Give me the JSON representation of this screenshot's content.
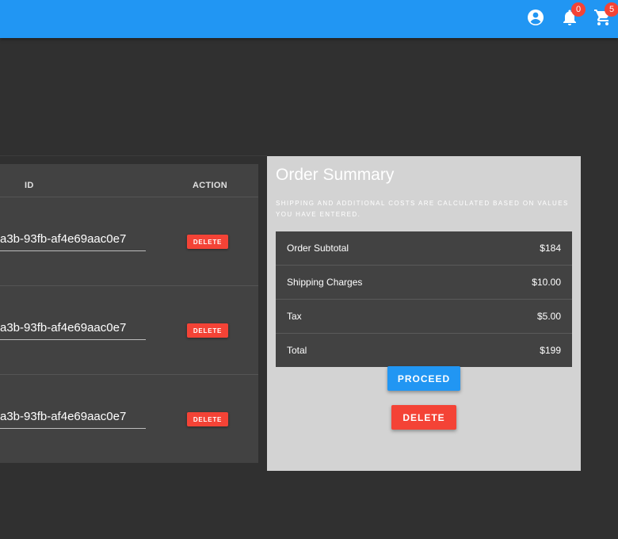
{
  "header": {
    "icons": [
      "account-circle-icon",
      "bell-icon",
      "cart-icon"
    ],
    "notification_count": "0",
    "cart_count": "5",
    "accent_color": "#2196f3"
  },
  "items_table": {
    "columns": {
      "id": "ID",
      "action": "ACTION"
    },
    "rows": [
      {
        "id": "a3b-93fb-af4e69aac0e7",
        "action": "DELETE"
      },
      {
        "id": "a3b-93fb-af4e69aac0e7",
        "action": "DELETE"
      },
      {
        "id": "a3b-93fb-af4e69aac0e7",
        "action": "DELETE"
      }
    ]
  },
  "order_summary": {
    "title": "Order Summary",
    "note": "Shipping and additional costs are calculated based on values you have entered.",
    "lines": [
      {
        "label": "Order Subtotal",
        "value": "$184"
      },
      {
        "label": "Shipping Charges",
        "value": "$10.00"
      },
      {
        "label": "Tax",
        "value": "$5.00"
      },
      {
        "label": "Total",
        "value": "$199"
      }
    ],
    "proceed_label": "PROCEED",
    "delete_label": "DELETE",
    "danger_color": "#f44336"
  }
}
